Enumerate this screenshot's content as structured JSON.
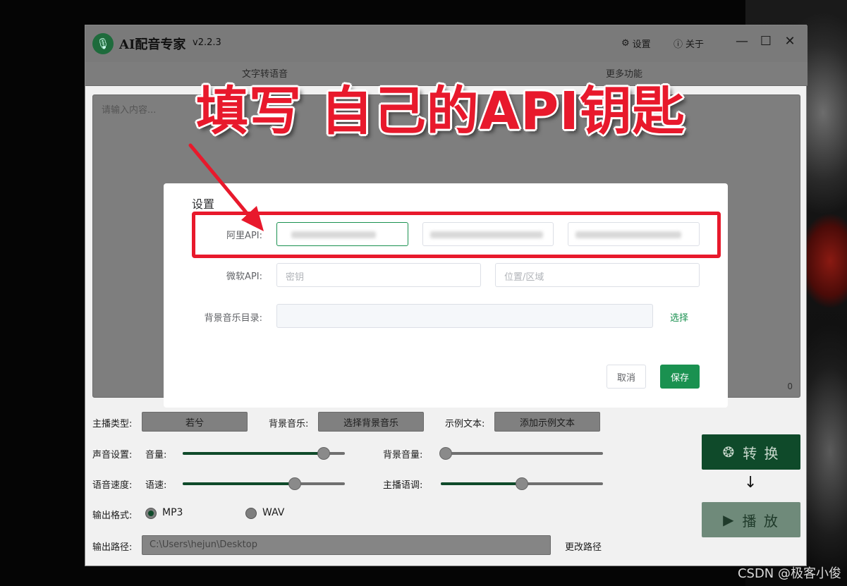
{
  "app": {
    "title": "AI配音专家",
    "version": "v2.2.3",
    "settings_label": "设置",
    "about_label": "关于",
    "minimize_glyph": "—",
    "maximize_glyph": "☐",
    "close_glyph": "✕"
  },
  "tabs": [
    {
      "label": "文字转语音"
    },
    {
      "label": "更多功能"
    }
  ],
  "editor": {
    "placeholder": "请输入内容...",
    "char_count": "0"
  },
  "controls": {
    "anchor_type_label": "主播类型:",
    "anchor_type_value": "若兮",
    "bgm_label": "背景音乐:",
    "bgm_button": "选择背景音乐",
    "sample_label": "示例文本:",
    "sample_button": "添加示例文本",
    "voice_settings_label": "声音设置:",
    "volume_label": "音量:",
    "volume_level": 0.87,
    "bg_volume_label": "背景音量:",
    "bg_volume_level": 0.03,
    "speed_row_label": "语音速度:",
    "speed_label": "语速:",
    "speed_level": 0.69,
    "pitch_label": "主播语调:",
    "pitch_level": 0.5,
    "format_label": "输出格式:",
    "format_options": [
      "MP3",
      "WAV"
    ],
    "format_selected": "MP3",
    "path_label": "输出路径:",
    "path_value": "C:\\Users\\hejun\\Desktop",
    "change_path": "更改路径",
    "convert_button": "转 换",
    "play_button": "播 放"
  },
  "dialog": {
    "title": "设置",
    "aliyun_label": "阿里API:",
    "microsoft_label": "微软API:",
    "ms_key_placeholder": "密钥",
    "ms_region_placeholder": "位置/区域",
    "bgm_dir_label": "背景音乐目录:",
    "bgm_dir_value": "",
    "choose_label": "选择",
    "cancel_label": "取消",
    "save_label": "保存"
  },
  "annotation": {
    "headline": "填写 自己的API钥匙",
    "color": "#e8192c"
  },
  "watermark": "CSDN @极客小俊",
  "colors": {
    "brand_green": "#1a9150",
    "dim_overlay": "#7a7a7a"
  }
}
